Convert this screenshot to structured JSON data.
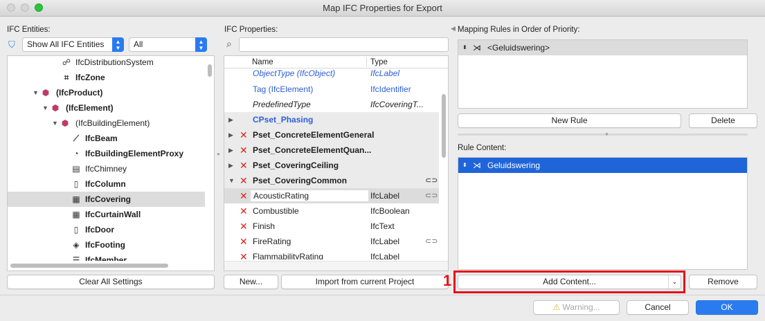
{
  "window": {
    "title": "Map IFC Properties for Export"
  },
  "entities": {
    "label": "IFC Entities:",
    "filter_value": "Show All IFC Entities",
    "scope_value": "All",
    "tree": [
      {
        "label": "IfcDistributionSystem",
        "icon": "☍"
      },
      {
        "label": "IfcZone",
        "icon": "⌗"
      },
      {
        "label": "(IfcProduct)",
        "icon": "⬢"
      },
      {
        "label": "(IfcElement)",
        "icon": "⬢"
      },
      {
        "label": "(IfcBuildingElement)",
        "icon": "⬢"
      },
      {
        "label": "IfcBeam",
        "icon": "⟋"
      },
      {
        "label": "IfcBuildingElementProxy",
        "icon": "◔"
      },
      {
        "label": "IfcChimney",
        "icon": "▤"
      },
      {
        "label": "IfcColumn",
        "icon": "▯"
      },
      {
        "label": "IfcCovering",
        "icon": "▦"
      },
      {
        "label": "IfcCurtainWall",
        "icon": "▦"
      },
      {
        "label": "IfcDoor",
        "icon": "▯"
      },
      {
        "label": "IfcFooting",
        "icon": "◈"
      },
      {
        "label": "IfcMember",
        "icon": "☰"
      }
    ],
    "clear_button": "Clear All Settings"
  },
  "properties": {
    "label": "IFC Properties:",
    "search_placeholder": "",
    "col_name": "Name",
    "col_type": "Type",
    "rows": [
      {
        "name": "ObjectType (IfcObject)",
        "type": "IfcLabel"
      },
      {
        "name": "Tag (IfcElement)",
        "type": "IfcIdentifier"
      },
      {
        "name": "PredefinedType",
        "type": "IfcCoveringT..."
      },
      {
        "name": "CPset_Phasing",
        "type": ""
      },
      {
        "name": "Pset_ConcreteElementGeneral",
        "type": ""
      },
      {
        "name": "Pset_ConcreteElementQuan...",
        "type": ""
      },
      {
        "name": "Pset_CoveringCeiling",
        "type": ""
      },
      {
        "name": "Pset_CoveringCommon",
        "type": ""
      },
      {
        "name": "AcousticRating",
        "type": "IfcLabel"
      },
      {
        "name": "Combustible",
        "type": "IfcBoolean"
      },
      {
        "name": "Finish",
        "type": "IfcText"
      },
      {
        "name": "FireRating",
        "type": "IfcLabel"
      },
      {
        "name": "FlammabilityRating",
        "type": "IfcLabel"
      }
    ],
    "new_button": "New...",
    "import_button": "Import from current Project"
  },
  "mapping": {
    "label": "Mapping Rules in Order of Priority:",
    "rule": "<Geluidswering>",
    "new_rule_button": "New Rule",
    "delete_button": "Delete",
    "content_label": "Rule Content:",
    "content_item": "Geluidswering",
    "add_content_button": "Add Content...",
    "remove_button": "Remove",
    "annotation_number": "1"
  },
  "footer": {
    "warning_button": "Warning...",
    "cancel_button": "Cancel",
    "ok_button": "OK"
  },
  "colors": {
    "accent": "#2b7bf0",
    "highlight": "#e5101b",
    "link_text": "#2c5ed8",
    "error_mark": "#e2231a"
  }
}
